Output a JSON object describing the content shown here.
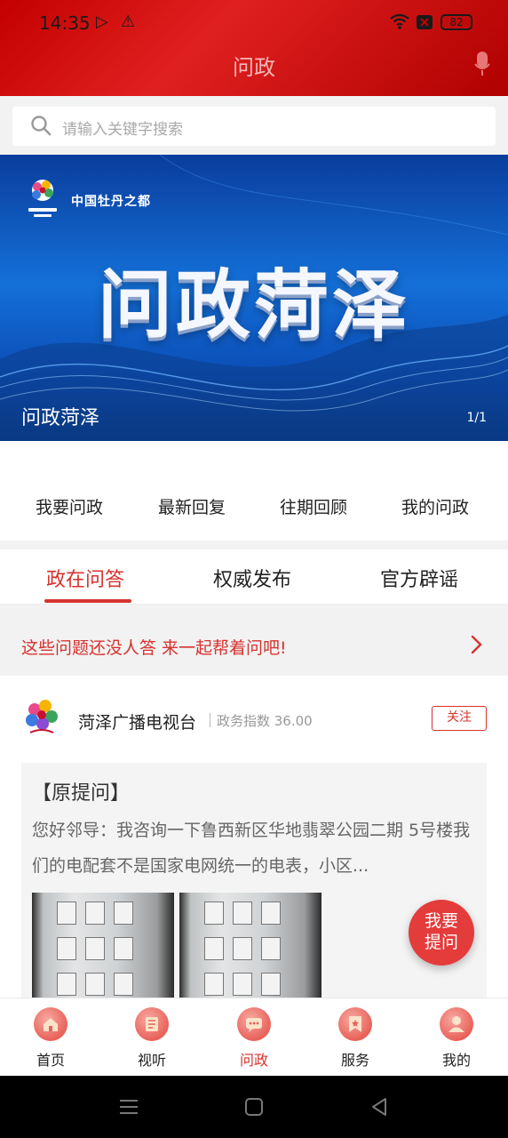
{
  "status": {
    "time": "14:35",
    "battery": "82"
  },
  "header": {
    "title": "问政"
  },
  "search": {
    "placeholder": "请输入关键字搜索"
  },
  "banner": {
    "brand": "中国牡丹之都",
    "headline": "问政菏泽",
    "caption": "问政菏泽",
    "pager": "1/1"
  },
  "quick_menu": [
    "我要问政",
    "最新回复",
    "往期回顾",
    "我的问政"
  ],
  "tabs": {
    "items": [
      "政在问答",
      "权威发布",
      "官方辟谣"
    ],
    "active": 0
  },
  "notice": {
    "text": "这些问题还没人答 来一起帮着问吧!"
  },
  "card": {
    "source": "菏泽广播电视台",
    "index": "政务指数 36.00",
    "follow": "关注",
    "q_title": "【原提问】",
    "q_text": "您好邻导：我咨询一下鲁西新区华地翡翠公园二期 5号楼我们的电配套不是国家电网统一的电表，小区..."
  },
  "fab": {
    "line1": "我要",
    "line2": "提问"
  },
  "bottom_nav": {
    "items": [
      "首页",
      "视听",
      "问政",
      "服务",
      "我的"
    ],
    "active": 2
  },
  "colors": {
    "brand_red": "#d6322e",
    "header_red": "#c40000",
    "banner_blue": "#1470d8"
  },
  "icons": [
    "search-icon",
    "mic-icon",
    "chevron-right-icon",
    "home-icon",
    "media-icon",
    "chat-icon",
    "service-icon",
    "profile-icon"
  ]
}
